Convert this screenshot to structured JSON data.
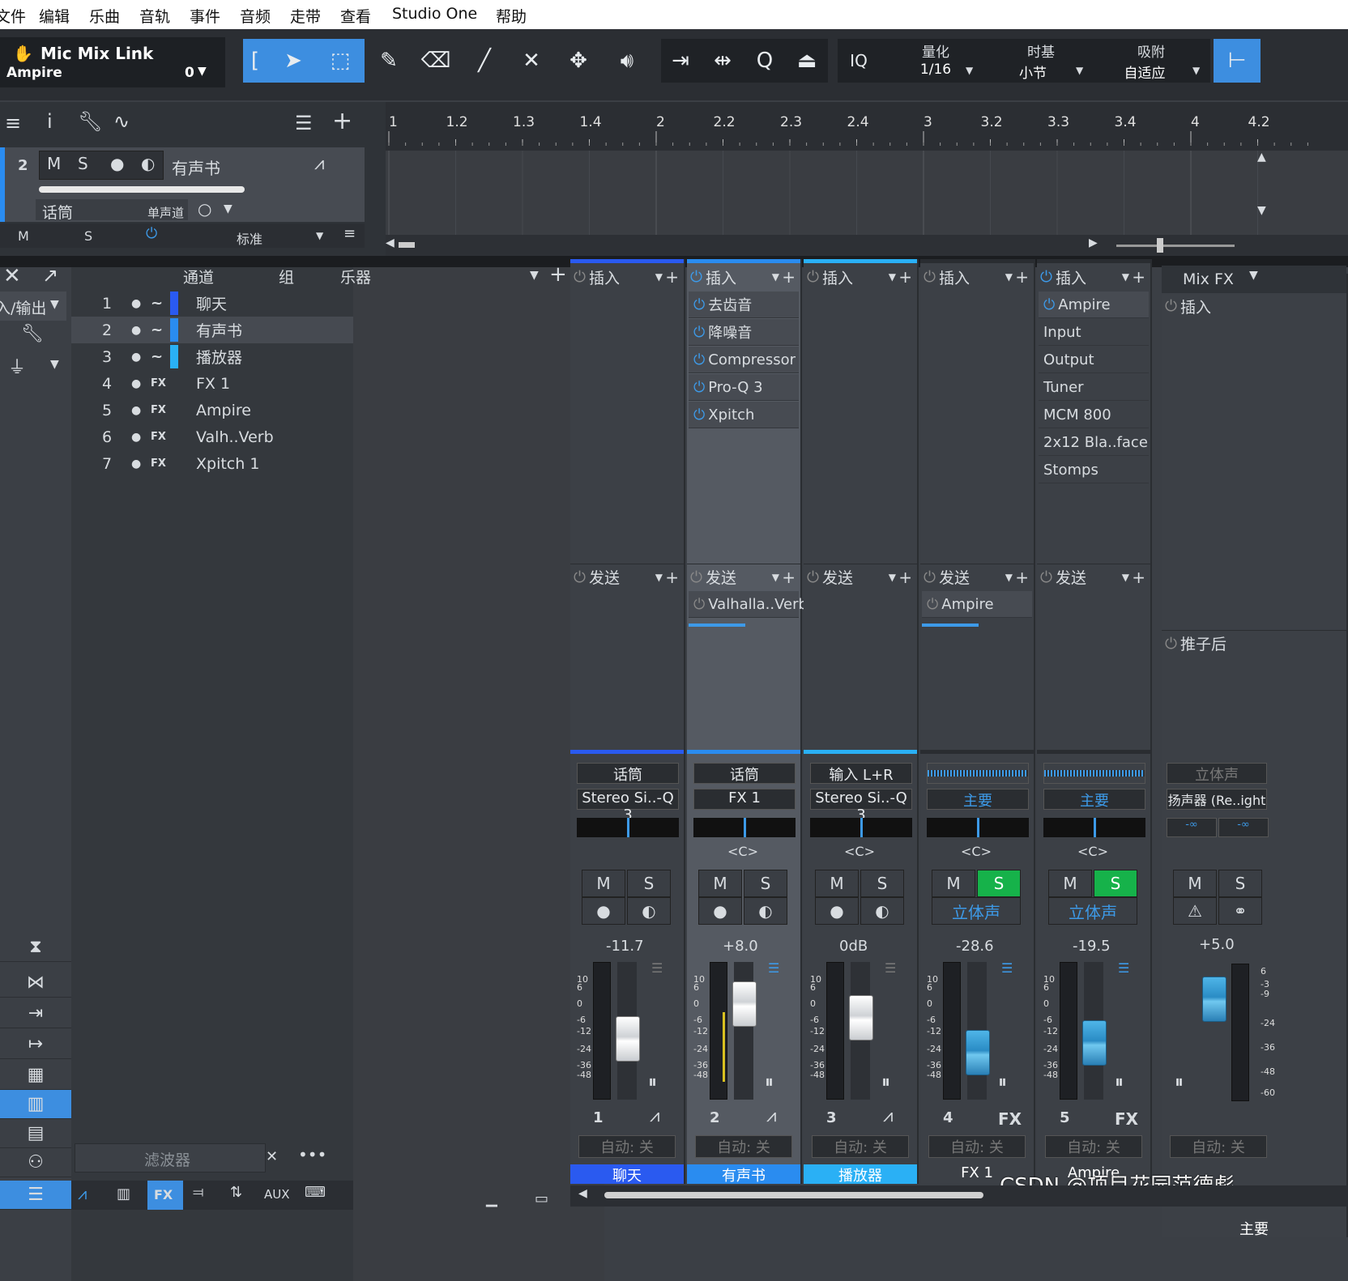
{
  "menu": [
    "文件",
    "编辑",
    "乐曲",
    "音轨",
    "事件",
    "音频",
    "走带",
    "查看",
    "Studio One",
    "帮助"
  ],
  "song": {
    "title": "Mic Mix Link",
    "subtitle": "Ampire",
    "value": "0"
  },
  "quant": {
    "label": "量化",
    "value": "1/16"
  },
  "timebase": {
    "label": "时基",
    "value": "小节"
  },
  "snap": {
    "label": "吸附",
    "value": "自适应"
  },
  "iq": "IQ",
  "ruler": [
    "1",
    "1.2",
    "1.3",
    "1.4",
    "2",
    "2.2",
    "2.3",
    "2.4",
    "3",
    "3.2",
    "3.3",
    "3.4",
    "4",
    "4.2"
  ],
  "track": {
    "num": "2",
    "m": "M",
    "s": "S",
    "name": "有声书",
    "input": "话筒",
    "mode": "单声道",
    "ms_m": "M",
    "ms_s": "S",
    "std": "标准"
  },
  "channels": {
    "col_channel": "通道",
    "col_group": "组",
    "col_instr": "乐器",
    "io": "入/输出",
    "rows": [
      {
        "n": "1",
        "t": "~",
        "name": "聊天",
        "color": "#2a5af0"
      },
      {
        "n": "2",
        "t": "~",
        "name": "有声书",
        "color": "#2a8cf0"
      },
      {
        "n": "3",
        "t": "~",
        "name": "播放器",
        "color": "#2ab0f5"
      },
      {
        "n": "4",
        "t": "FX",
        "name": "FX 1",
        "color": ""
      },
      {
        "n": "5",
        "t": "FX",
        "name": "Ampire",
        "color": ""
      },
      {
        "n": "6",
        "t": "FX",
        "name": "Valh..Verb",
        "color": ""
      },
      {
        "n": "7",
        "t": "FX",
        "name": "Xpitch 1",
        "color": ""
      }
    ],
    "filter": "滤波器"
  },
  "bottom_tabs": [
    "FX",
    "AUX"
  ],
  "strips": [
    {
      "insert": "插入",
      "send": "发送",
      "inserts": [],
      "sends": [],
      "input": "话筒",
      "output": "Stereo Si..-Q 3",
      "pan": "",
      "m": "M",
      "s": "S",
      "vol": "-11.7",
      "num": "1",
      "auto": "自动: 关",
      "name": "聊天",
      "color": "#2a5af0",
      "fader": 0.45,
      "blue": false,
      "fx": "",
      "solo": false
    },
    {
      "insert": "插入",
      "send": "发送",
      "inserts": [
        "去齿音",
        "降噪音",
        "Compressor",
        "Pro-Q 3",
        "Xpitch"
      ],
      "sends": [
        "Valhalla..Verb"
      ],
      "input": "话筒",
      "output": "FX 1",
      "pan": "<C>",
      "m": "M",
      "s": "S",
      "vol": "+8.0",
      "num": "2",
      "auto": "自动: 关",
      "name": "有声书",
      "color": "#2a8cf0",
      "fader": 0.2,
      "blue": false,
      "fx": "",
      "solo": false
    },
    {
      "insert": "插入",
      "send": "发送",
      "inserts": [],
      "sends": [],
      "input": "输入 L+R",
      "output": "Stereo Si..-Q 3",
      "pan": "<C>",
      "m": "M",
      "s": "S",
      "vol": "0dB",
      "num": "3",
      "auto": "自动: 关",
      "name": "播放器",
      "color": "#2ab0f5",
      "fader": 0.3,
      "blue": false,
      "fx": "",
      "solo": false
    },
    {
      "insert": "插入",
      "send": "发送",
      "inserts": [],
      "sends": [
        "Ampire"
      ],
      "input": "",
      "output": "主要",
      "pan": "<C>",
      "m": "M",
      "s": "S",
      "stereo": "立体声",
      "vol": "-28.6",
      "num": "4",
      "auto": "自动: 关",
      "name": "FX 1",
      "color": "",
      "fader": 0.55,
      "blue": true,
      "fx": "FX",
      "solo": true
    },
    {
      "insert": "插入",
      "send": "发送",
      "inserts": [
        "Ampire",
        "Input",
        "Output",
        "Tuner",
        "MCM 800",
        "2x12 Bla..face",
        "Stomps"
      ],
      "sends": [],
      "input": "",
      "output": "主要",
      "pan": "<C>",
      "m": "M",
      "s": "S",
      "stereo": "立体声",
      "vol": "-19.5",
      "num": "5",
      "auto": "自动: 关",
      "name": "Ampire",
      "color": "",
      "fader": 0.48,
      "blue": true,
      "fx": "FX",
      "solo": true
    }
  ],
  "master": {
    "title": "Mix FX",
    "insert": "插入",
    "post": "推子后",
    "input": "立体声",
    "output": "扬声器 (Re..ight",
    "inf1": "-∞",
    "inf2": "-∞",
    "m": "M",
    "s": "S",
    "vol": "+5.0",
    "auto": "自动: 关",
    "name": "主要"
  },
  "scale": [
    "10",
    "6",
    "0",
    "-6",
    "-12",
    "-24",
    "-36",
    "-48"
  ],
  "mscale": [
    "6",
    "-3",
    "-9",
    "-24",
    "-36",
    "-48",
    "-60"
  ],
  "watermark": "CSDN @项目花园范德彪"
}
